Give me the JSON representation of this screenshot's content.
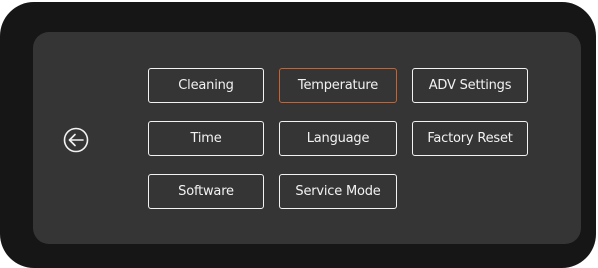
{
  "menu": {
    "back_icon": "back-arrow-circle-icon",
    "active_color": "#c8622f",
    "items": [
      {
        "label": "Cleaning"
      },
      {
        "label": "Temperature"
      },
      {
        "label": "ADV Settings"
      },
      {
        "label": "Time"
      },
      {
        "label": "Language"
      },
      {
        "label": "Factory Reset"
      },
      {
        "label": "Software"
      },
      {
        "label": "Service Mode"
      }
    ],
    "selected": "Temperature"
  }
}
